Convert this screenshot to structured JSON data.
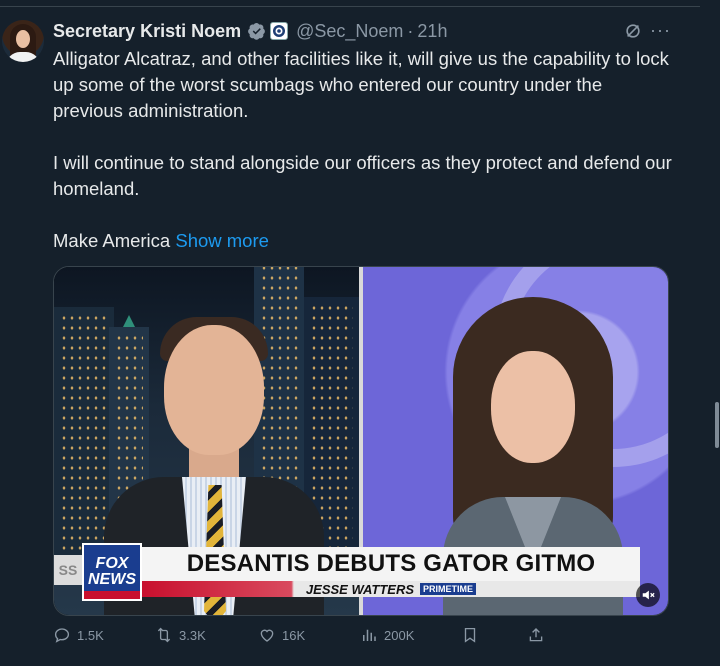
{
  "tweet": {
    "author_name": "Secretary Kristi Noem",
    "handle": "@Sec_Noem",
    "separator": "·",
    "time": "21h",
    "icons": {
      "verified": "verified-badge-icon",
      "org": "dhs-seal-icon",
      "grok": "grok-icon",
      "more": "more-icon"
    },
    "body": {
      "para1": "Alligator Alcatraz, and other facilities like it, will give us the capability to lock up some of the worst scumbags who entered our country under the previous administration.",
      "para2": "I will continue to stand alongside our officers as they protect and defend our homeland.",
      "para3_prefix": "Make America ",
      "show_more": "Show more"
    },
    "media": {
      "network_logo_line1": "FOX",
      "network_logo_line2": "NEWS",
      "left_ticker": "SS",
      "headline": "DESANTIS DEBUTS GATOR GITMO",
      "show_name": "JESSE WATTERS",
      "show_tag": "PRIMETIME",
      "mute_icon": "mute-icon"
    },
    "actions": {
      "replies": "1.5K",
      "reposts": "3.3K",
      "likes": "16K",
      "views": "200K"
    }
  },
  "colors": {
    "background": "#15202b",
    "text": "#e7e9ea",
    "muted": "#8b98a5",
    "link": "#1d9bf0",
    "verified": "#8b98a5"
  }
}
